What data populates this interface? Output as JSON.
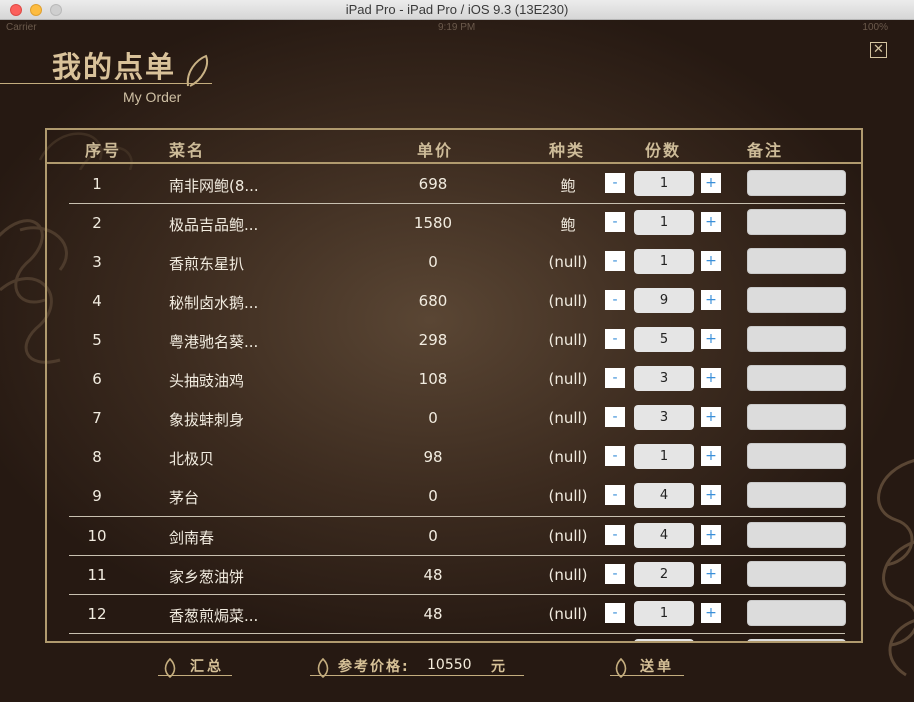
{
  "window": {
    "title": "iPad Pro - iPad Pro / iOS 9.3 (13E230)"
  },
  "status_bar": {
    "carrier": "Carrier",
    "time": "9:19 PM",
    "battery": "100%"
  },
  "page": {
    "title_cn": "我的点单",
    "title_en": "My Order",
    "close_glyph": "✕"
  },
  "table": {
    "headers": {
      "num": "序号",
      "name": "菜名",
      "price": "单价",
      "type": "种类",
      "qty": "份数",
      "note": "备注"
    },
    "rows": [
      {
        "num": "1",
        "name": "南非网鲍(8...",
        "price": "698",
        "type": "鲍",
        "minus": "-",
        "qty": "1",
        "plus": "+"
      },
      {
        "num": "2",
        "name": "极品吉品鲍...",
        "price": "1580",
        "type": "鲍",
        "minus": "-",
        "qty": "1",
        "plus": "+"
      },
      {
        "num": "3",
        "name": "香煎东星扒",
        "price": "0",
        "type": "(null)",
        "minus": "-",
        "qty": "1",
        "plus": "+"
      },
      {
        "num": "4",
        "name": "秘制卤水鹅...",
        "price": "680",
        "type": "(null)",
        "minus": "-",
        "qty": "9",
        "plus": "+"
      },
      {
        "num": "5",
        "name": "粤港驰名葵...",
        "price": "298",
        "type": "(null)",
        "minus": "-",
        "qty": "5",
        "plus": "+"
      },
      {
        "num": "6",
        "name": "头抽豉油鸡",
        "price": "108",
        "type": "(null)",
        "minus": "-",
        "qty": "3",
        "plus": "+"
      },
      {
        "num": "7",
        "name": "象拔蚌刺身",
        "price": "0",
        "type": "(null)",
        "minus": "-",
        "qty": "3",
        "plus": "+"
      },
      {
        "num": "8",
        "name": "北极贝",
        "price": "98",
        "type": "(null)",
        "minus": "-",
        "qty": "1",
        "plus": "+"
      },
      {
        "num": "9",
        "name": "茅台",
        "price": "0",
        "type": "(null)",
        "minus": "-",
        "qty": "4",
        "plus": "+"
      },
      {
        "num": "10",
        "name": "剑南春",
        "price": "0",
        "type": "(null)",
        "minus": "-",
        "qty": "4",
        "plus": "+"
      },
      {
        "num": "11",
        "name": "家乡葱油饼",
        "price": "48",
        "type": "(null)",
        "minus": "-",
        "qty": "2",
        "plus": "+"
      },
      {
        "num": "12",
        "name": "香葱煎焗菜...",
        "price": "48",
        "type": "(null)",
        "minus": "-",
        "qty": "1",
        "plus": "+"
      }
    ]
  },
  "footer": {
    "summary_label": "汇总",
    "ref_price_label": "参考价格:",
    "total": "10550",
    "currency": "元",
    "submit_label": "送单"
  },
  "colors": {
    "accent_gold": "#b09a6e",
    "step_blue": "#3a8fd9"
  }
}
